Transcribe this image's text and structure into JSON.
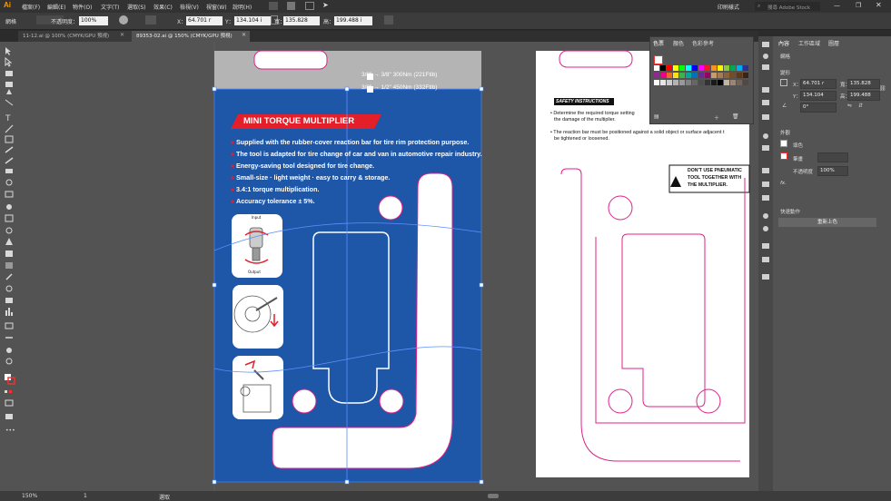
{
  "app": {
    "logo": "Ai"
  },
  "menubar": {
    "items": [
      "檔案(F)",
      "編輯(E)",
      "物件(O)",
      "文字(T)",
      "選取(S)",
      "效果(C)",
      "檢視(V)",
      "視窗(W)",
      "說明(H)"
    ],
    "workspace": "印刷樣式",
    "search_placeholder": "搜尋 Adobe Stock"
  },
  "control": {
    "kind": "網格",
    "opacity_label": "不透明度：",
    "opacity_value": "100%",
    "x_label": "X：",
    "x_value": "64.701 r",
    "y_label": "Y：",
    "y_value": "134.104 i",
    "w_label": "寬：",
    "w_value": "135.828",
    "h_label": "高：",
    "h_value": "199.488 i"
  },
  "tabs": [
    {
      "label": "11-12.ai @ 100% (CMYK/GPU 預視)"
    },
    {
      "label": "89353-02.ai @ 150% (CMYK/GPU 預視)"
    }
  ],
  "artwork": {
    "size_row1": "3/8\" → 3/8\" 300Nm (221Ftlb)",
    "size_row2": "3/8\" → 1/2\" 450Nm (332Ftlb)",
    "title": "MINI TORQUE MULTIPLIER",
    "features": [
      "Supplied with the rubber-cover reaction bar for tire rim protection purpose.",
      "The tool is adapted for tire change of car and van in automotive repair industry.",
      "Energy-saving tool designed for tire change.",
      "Small-size · light weight · easy to carry & storage.",
      "3.4:1 torque multiplication.",
      "Accuracy tolerance ± 5%."
    ],
    "fig_input": "Input",
    "fig_output": "Output"
  },
  "artboard2": {
    "safety_title": "SAFETY INSTRUCTIONS",
    "safety_1a": "• Determine the required torque setting",
    "safety_1b": "the damage of the multiplier.",
    "safety_2a": "• The reaction bar must be positioned against a solid object or surface adjacent t",
    "safety_2b": "be tightened or loosened.",
    "warn_1": "DON'T USE PNEUMATIC",
    "warn_2": "TOOL TOGETHER WITH",
    "warn_3": "THE MULTIPLIER."
  },
  "swatches_panel": {
    "tabs": [
      "色票",
      "顏色",
      "色彩參考"
    ],
    "colors": [
      "#ffffff",
      "#000000",
      "#ff0000",
      "#ffff00",
      "#00ff00",
      "#00ffff",
      "#0000ff",
      "#ff00ff",
      "#ed1c24",
      "#f7941d",
      "#fff200",
      "#8dc63f",
      "#00a651",
      "#00aeef",
      "#2e3192",
      "#92278f",
      "#ec008c",
      "#f26522",
      "#ffde17",
      "#39b54a",
      "#00a99d",
      "#0072bc",
      "#662d91",
      "#9e005d",
      "#c69c6d",
      "#a67c52",
      "#8c6239",
      "#754c24",
      "#603913",
      "#3c2415",
      "#ffffff",
      "#e6e6e6",
      "#cccccc",
      "#b3b3b3",
      "#999999",
      "#808080",
      "#666666",
      "#4d4d4d",
      "#333333",
      "#1a1a1a",
      "#000000",
      "#c2b59b",
      "#998675",
      "#736357",
      "#534741"
    ]
  },
  "properties_panel": {
    "tabs": [
      "內容",
      "工作區域",
      "圖層"
    ],
    "section_kind": "網格",
    "section_transform": "變形",
    "x_label": "X：",
    "x_value": "64.701 r",
    "y_label": "Y：",
    "y_value": "134.104",
    "w_label": "寬：",
    "w_value": "135.828",
    "h_label": "高：",
    "h_value": "199.488",
    "angle": "0°",
    "section_appearance": "外觀",
    "fill_label": "填色",
    "stroke_label": "筆畫",
    "opacity_label": "不透明度",
    "opacity_value": "100%",
    "fx": "fx.",
    "section_quick": "快速動作",
    "recolor_button": "重新上色"
  },
  "status": {
    "zoom": "150%",
    "page": "1",
    "mode": "選取"
  }
}
